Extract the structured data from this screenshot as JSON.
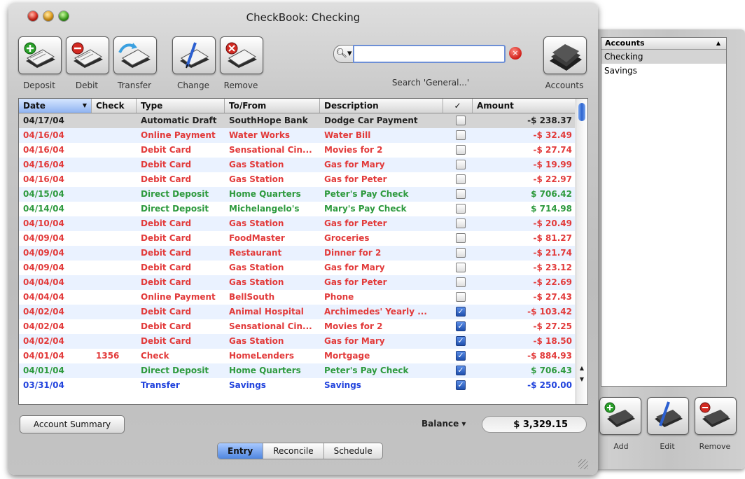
{
  "window": {
    "title": "CheckBook: Checking"
  },
  "toolbar": {
    "buttons": [
      {
        "label": "Deposit",
        "icon": "checkbook-plus-icon",
        "badge": "#2aa02a"
      },
      {
        "label": "Debit",
        "icon": "checkbook-minus-icon",
        "badge": "#d22a22"
      },
      {
        "label": "Transfer",
        "icon": "checkbook-transfer-icon",
        "badge": "#3aa0e0"
      },
      {
        "label": "Change",
        "icon": "checkbook-pen-icon",
        "badge": "#2b5fd0"
      },
      {
        "label": "Remove",
        "icon": "checkbook-remove-icon",
        "badge": "#d22a22"
      }
    ],
    "search_label": "Search 'General...'",
    "search_value": "",
    "accounts_label": "Accounts"
  },
  "table": {
    "columns": [
      "Date",
      "Check",
      "Type",
      "To/From",
      "Description",
      "✓",
      "Amount"
    ],
    "rows": [
      {
        "date": "04/17/04",
        "check": "",
        "type": "Automatic Draft",
        "tofrom": "SouthHope Bank",
        "desc": "Dodge Car Payment",
        "checked": false,
        "amount": "-$ 238.37",
        "color": "#222222"
      },
      {
        "date": "04/16/04",
        "check": "",
        "type": "Online Payment",
        "tofrom": "Water Works",
        "desc": "Water Bill",
        "checked": false,
        "amount": "-$ 32.49",
        "color": "#e23b3b"
      },
      {
        "date": "04/16/04",
        "check": "",
        "type": "Debit Card",
        "tofrom": "Sensational Cin...",
        "desc": "Movies for 2",
        "checked": false,
        "amount": "-$ 27.74",
        "color": "#e23b3b"
      },
      {
        "date": "04/16/04",
        "check": "",
        "type": "Debit Card",
        "tofrom": "Gas Station",
        "desc": "Gas for Mary",
        "checked": false,
        "amount": "-$ 19.99",
        "color": "#e23b3b"
      },
      {
        "date": "04/16/04",
        "check": "",
        "type": "Debit Card",
        "tofrom": "Gas Station",
        "desc": "Gas for Peter",
        "checked": false,
        "amount": "-$ 22.97",
        "color": "#e23b3b"
      },
      {
        "date": "04/15/04",
        "check": "",
        "type": "Direct Deposit",
        "tofrom": "Home Quarters",
        "desc": "Peter's Pay Check",
        "checked": false,
        "amount": "$ 706.42",
        "color": "#2e9a3e"
      },
      {
        "date": "04/14/04",
        "check": "",
        "type": "Direct Deposit",
        "tofrom": "Michelangelo's",
        "desc": "Mary's Pay Check",
        "checked": false,
        "amount": "$ 714.98",
        "color": "#2e9a3e"
      },
      {
        "date": "04/10/04",
        "check": "",
        "type": "Debit Card",
        "tofrom": "Gas Station",
        "desc": "Gas for Peter",
        "checked": false,
        "amount": "-$ 20.49",
        "color": "#e23b3b"
      },
      {
        "date": "04/09/04",
        "check": "",
        "type": "Debit Card",
        "tofrom": "FoodMaster",
        "desc": "Groceries",
        "checked": false,
        "amount": "-$ 81.27",
        "color": "#e23b3b"
      },
      {
        "date": "04/09/04",
        "check": "",
        "type": "Debit Card",
        "tofrom": "Restaurant",
        "desc": "Dinner for 2",
        "checked": false,
        "amount": "-$ 21.74",
        "color": "#e23b3b"
      },
      {
        "date": "04/09/04",
        "check": "",
        "type": "Debit Card",
        "tofrom": "Gas Station",
        "desc": "Gas for Mary",
        "checked": false,
        "amount": "-$ 23.12",
        "color": "#e23b3b"
      },
      {
        "date": "04/04/04",
        "check": "",
        "type": "Debit Card",
        "tofrom": "Gas Station",
        "desc": "Gas for Peter",
        "checked": false,
        "amount": "-$ 22.69",
        "color": "#e23b3b"
      },
      {
        "date": "04/04/04",
        "check": "",
        "type": "Online Payment",
        "tofrom": "BellSouth",
        "desc": "Phone",
        "checked": false,
        "amount": "-$ 27.43",
        "color": "#e23b3b"
      },
      {
        "date": "04/02/04",
        "check": "",
        "type": "Debit Card",
        "tofrom": "Animal Hospital",
        "desc": "Archimedes' Yearly ...",
        "checked": true,
        "amount": "-$ 103.42",
        "color": "#e23b3b"
      },
      {
        "date": "04/02/04",
        "check": "",
        "type": "Debit Card",
        "tofrom": "Sensational Cin...",
        "desc": "Movies for 2",
        "checked": true,
        "amount": "-$ 27.25",
        "color": "#e23b3b"
      },
      {
        "date": "04/02/04",
        "check": "",
        "type": "Debit Card",
        "tofrom": "Gas Station",
        "desc": "Gas for Mary",
        "checked": true,
        "amount": "-$ 18.50",
        "color": "#e23b3b"
      },
      {
        "date": "04/01/04",
        "check": "1356",
        "type": "Check",
        "tofrom": "HomeLenders",
        "desc": "Mortgage",
        "checked": true,
        "amount": "-$ 884.93",
        "color": "#e23b3b"
      },
      {
        "date": "04/01/04",
        "check": "",
        "type": "Direct Deposit",
        "tofrom": "Home Quarters",
        "desc": "Peter's Pay Check",
        "checked": true,
        "amount": "$ 706.43",
        "color": "#2e9a3e"
      },
      {
        "date": "03/31/04",
        "check": "",
        "type": "Transfer",
        "tofrom": "Savings",
        "desc": "Savings",
        "checked": true,
        "amount": "-$ 250.00",
        "color": "#2244dd"
      }
    ]
  },
  "footer": {
    "summary_button": "Account Summary",
    "balance_label": "Balance ▾",
    "balance_value": "$ 3,329.15",
    "tabs": [
      "Entry",
      "Reconcile",
      "Schedule"
    ],
    "active_tab": "Entry"
  },
  "drawer": {
    "header": "Accounts",
    "accounts": [
      "Checking",
      "Savings"
    ],
    "buttons": [
      "Add",
      "Edit",
      "Remove"
    ]
  }
}
